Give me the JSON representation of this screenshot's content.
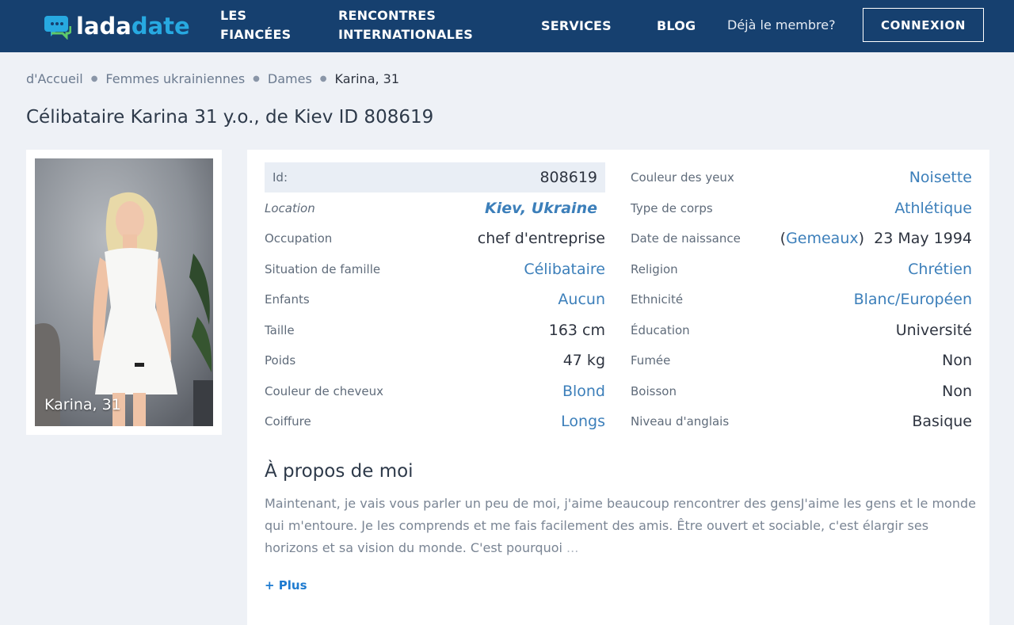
{
  "header": {
    "logo_part1": "lada",
    "logo_part2": "date",
    "nav": {
      "fiancees_line1": "LES",
      "fiancees_line2": "FIANCÉES",
      "rencontres_line1": "RENCONTRES",
      "rencontres_line2": "INTERNATIONALES",
      "services": "SERVICES",
      "blog": "BLOG"
    },
    "member_text": "Déjà le membre?",
    "login_label": "CONNEXION"
  },
  "breadcrumb": {
    "home": "d'Accueil",
    "women": "Femmes ukrainiennes",
    "ladies": "Dames",
    "current": "Karina, 31"
  },
  "page_title": "Célibataire Karina 31 y.o., de Kiev ID 808619",
  "photo": {
    "caption": "Karina, 31"
  },
  "profile": {
    "left": [
      {
        "label": "Id:",
        "value": "808619"
      },
      {
        "label": "Location",
        "value": "Kiev, Ukraine"
      },
      {
        "label": "Occupation",
        "value": "chef d'entreprise"
      },
      {
        "label": "Situation de famille",
        "value": "Célibataire"
      },
      {
        "label": "Enfants",
        "value": "Aucun"
      },
      {
        "label": "Taille",
        "value": "163 cm"
      },
      {
        "label": "Poids",
        "value": "47 kg"
      },
      {
        "label": "Couleur de cheveux",
        "value": "Blond"
      },
      {
        "label": "Coiffure",
        "value": "Longs"
      }
    ],
    "right": [
      {
        "label": "Couleur des yeux",
        "value": "Noisette"
      },
      {
        "label": "Type de corps",
        "value": "Athlétique"
      },
      {
        "label": "Date de naissance",
        "zodiac": "Gemeaux",
        "value": "23 May 1994"
      },
      {
        "label": "Religion",
        "value": "Chrétien"
      },
      {
        "label": "Ethnicité",
        "value": "Blanc/Européen"
      },
      {
        "label": "Éducation",
        "value": "Université"
      },
      {
        "label": "Fumée",
        "value": "Non"
      },
      {
        "label": "Boisson",
        "value": "Non"
      },
      {
        "label": "Niveau d'anglais",
        "value": "Basique"
      }
    ]
  },
  "about": {
    "title": "À propos de moi",
    "text": "Maintenant, je vais vous parler un peu de moi, j'aime beaucoup rencontrer des gensJ'aime les gens et le monde qui m'entoure. Je les comprends et me fais facilement des amis. Être ouvert et sociable, c'est élargir ses horizons et sa vision du monde. C'est pourquoi",
    "ellipsis": "...",
    "more_label": "+ Plus"
  },
  "colors": {
    "header_bg": "#16406f",
    "link": "#3c7fba",
    "accent": "#27a9e1",
    "page_bg": "#eef1f6"
  },
  "icons": {
    "logo": "chat-bubble-icon"
  }
}
